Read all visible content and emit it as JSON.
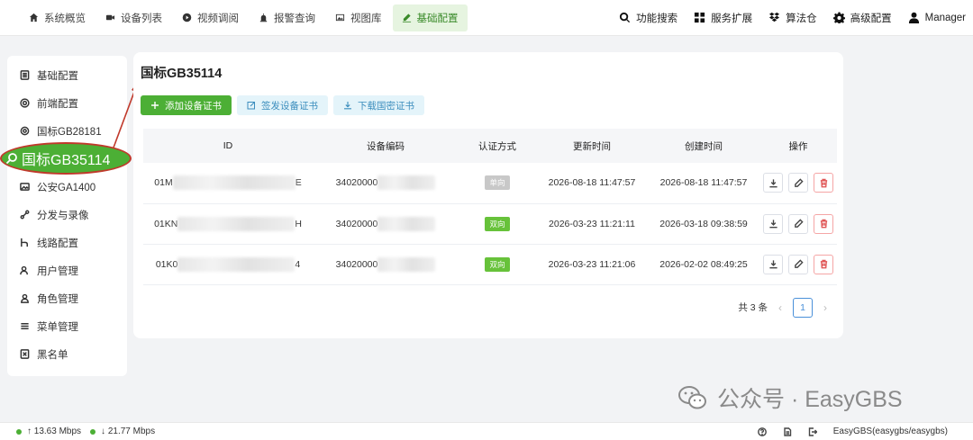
{
  "nav": {
    "items": [
      {
        "label": "系统概览",
        "icon": "home-icon"
      },
      {
        "label": "设备列表",
        "icon": "video-camera-icon"
      },
      {
        "label": "视频调阅",
        "icon": "play-circle-icon"
      },
      {
        "label": "报警查询",
        "icon": "alarm-icon"
      },
      {
        "label": "视图库",
        "icon": "image-icon"
      },
      {
        "label": "基础配置",
        "icon": "edit-icon",
        "active": true
      }
    ],
    "tools": [
      {
        "label": "功能搜索",
        "icon": "search-icon"
      },
      {
        "label": "服务扩展",
        "icon": "grid-icon"
      },
      {
        "label": "算法仓",
        "icon": "dropbox-icon"
      },
      {
        "label": "高级配置",
        "icon": "gear-icon"
      },
      {
        "label": "Manager",
        "icon": "user-icon"
      }
    ]
  },
  "sidebar": {
    "items": [
      {
        "label": "基础配置",
        "icon": "list-icon"
      },
      {
        "label": "前端配置",
        "icon": "target-icon"
      },
      {
        "label": "国标GB28181",
        "icon": "gear-icon"
      },
      {
        "label": "国标GB35114",
        "icon": "search-icon",
        "selected": true
      },
      {
        "label": "公安GA1400",
        "icon": "image-icon"
      },
      {
        "label": "分发与录像",
        "icon": "share-icon"
      },
      {
        "label": "线路配置",
        "icon": "route-icon"
      },
      {
        "label": "用户管理",
        "icon": "user-icon"
      },
      {
        "label": "角色管理",
        "icon": "role-icon"
      },
      {
        "label": "菜单管理",
        "icon": "menu-icon"
      },
      {
        "label": "黑名单",
        "icon": "blacklist-icon"
      }
    ],
    "highlight_label": "国标GB35114"
  },
  "main": {
    "title": "国标GB35114",
    "buttons": {
      "add": "添加设备证书",
      "sign": "签发设备证书",
      "download": "下载国密证书"
    },
    "table": {
      "headers": [
        "ID",
        "设备编码",
        "认证方式",
        "更新时间",
        "创建时间",
        "操作"
      ],
      "rows": [
        {
          "id_prefix": "01M",
          "id_suffix": "E",
          "code_prefix": "34020000",
          "auth": "单向",
          "auth_color": "#c8c8c8",
          "updated": "2026-08-18 11:47:57",
          "created": "2026-08-18 11:47:57"
        },
        {
          "id_prefix": "01KN",
          "id_suffix": "H",
          "code_prefix": "34020000",
          "auth": "双向",
          "auth_color": "#67c23a",
          "updated": "2026-03-23 11:21:11",
          "created": "2026-03-18 09:38:59"
        },
        {
          "id_prefix": "01K0",
          "id_suffix": "4",
          "code_prefix": "34020000",
          "auth": "双向",
          "auth_color": "#67c23a",
          "updated": "2026-03-23 11:21:06",
          "created": "2026-02-02 08:49:25"
        }
      ]
    },
    "pagination": {
      "total_text": "共 3 条",
      "current_page": "1"
    }
  },
  "footer": {
    "up_speed": "↑ 13.63 Mbps",
    "down_speed": "↓ 21.77 Mbps",
    "version": "EasyGBS(easygbs/easygbs)"
  },
  "watermark": {
    "text": "公众号 · EasyGBS"
  },
  "colors": {
    "primary": "#4caf35",
    "danger": "#e05656",
    "annotation": "#c0392b"
  }
}
